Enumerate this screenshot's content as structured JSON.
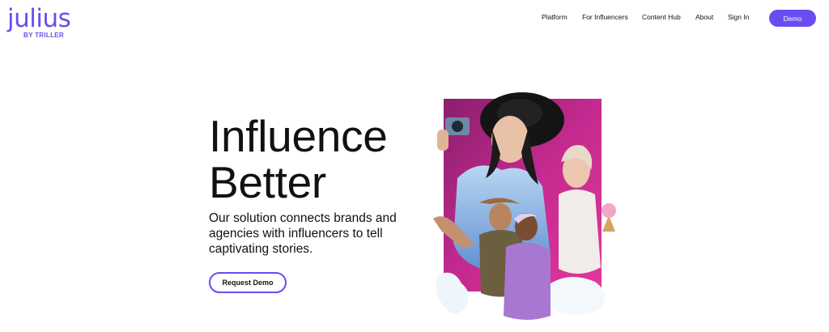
{
  "brand": {
    "logo_word": "julius",
    "logo_sub": "BY TRILLER",
    "accent": "#6a4cf0"
  },
  "nav": {
    "items": [
      "Platform",
      "For Influencers",
      "Content Hub",
      "About",
      "Sign In"
    ],
    "demo_label": "Demo"
  },
  "hero": {
    "title_line1": "Influence",
    "title_line2": "Better",
    "description": "Our solution connects brands and agencies with influencers to tell captivating stories.",
    "cta_label": "Request Demo"
  },
  "collage": {
    "background": "#b1248a",
    "description_icon": "influencer-collage-illustration"
  }
}
